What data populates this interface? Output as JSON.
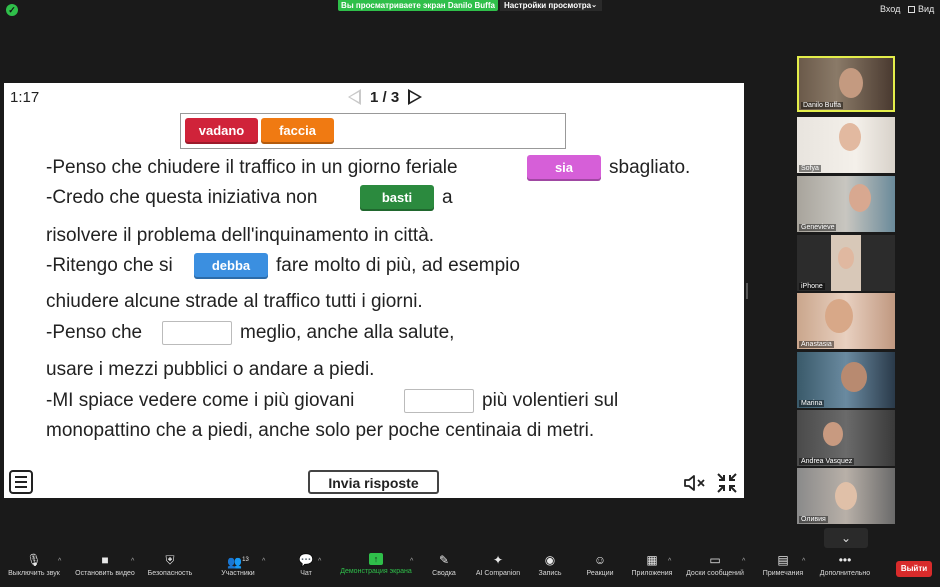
{
  "top_bar": {
    "viewing_banner": "Вы просматриваете экран Danilo Buffa",
    "view_options": "Настройки просмотра",
    "login": "Вход",
    "view": "Вид"
  },
  "exercise": {
    "timer": "1:17",
    "page": "1 / 3",
    "word_bank": [
      {
        "label": "vadano",
        "color": "#d0233a"
      },
      {
        "label": "faccia",
        "color": "#f07a12"
      }
    ],
    "lines": {
      "l1_a": "-Penso che chiudere il traffico in un giorno feriale",
      "l1_chip": "sia",
      "l1_b": "sbagliato.",
      "l2_a": "-Credo che questa iniziativa non",
      "l2_chip": "basti",
      "l2_b": "a",
      "l3": "risolvere il problema dell'inquinamento in città.",
      "l4_a": "-Ritengo che si",
      "l4_chip": "debba",
      "l4_b": "fare molto di più, ad esempio",
      "l5": "chiudere alcune strade al traffico tutti i giorni.",
      "l6_a": "-Penso che",
      "l6_b": "meglio, anche alla salute,",
      "l7": "usare i mezzi pubblici o andare a piedi.",
      "l8_a": "-MI spiace vedere come i più giovani",
      "l8_b": "più volentieri sul",
      "l9": "monopattino che a piedi, anche solo per poche centinaia di metri."
    },
    "chip_colors": {
      "sia": "#d65fd8",
      "basti": "#2b8a3e",
      "debba": "#3b8fe0"
    },
    "submit": "Invia risposte"
  },
  "participants": [
    {
      "name": "Danilo Buffa"
    },
    {
      "name": "Sofya"
    },
    {
      "name": "Genevieve"
    },
    {
      "name": "iPhone"
    },
    {
      "name": "Anastasia"
    },
    {
      "name": "Marina"
    },
    {
      "name": "Andrea Vasquez"
    },
    {
      "name": "Оливия"
    }
  ],
  "toolbar": {
    "mic": "Выключить звук",
    "video": "Остановить видео",
    "security": "Безопасность",
    "participants": "Участники",
    "participants_count": "13",
    "chat": "Чат",
    "share": "Демонстрация экрана",
    "summary": "Сводка",
    "ai": "AI Companion",
    "record": "Запись",
    "reactions": "Реакции",
    "apps": "Приложения",
    "whiteboards": "Доски сообщений",
    "notes": "Примечания",
    "more": "Дополнительно",
    "leave": "Выйти"
  }
}
